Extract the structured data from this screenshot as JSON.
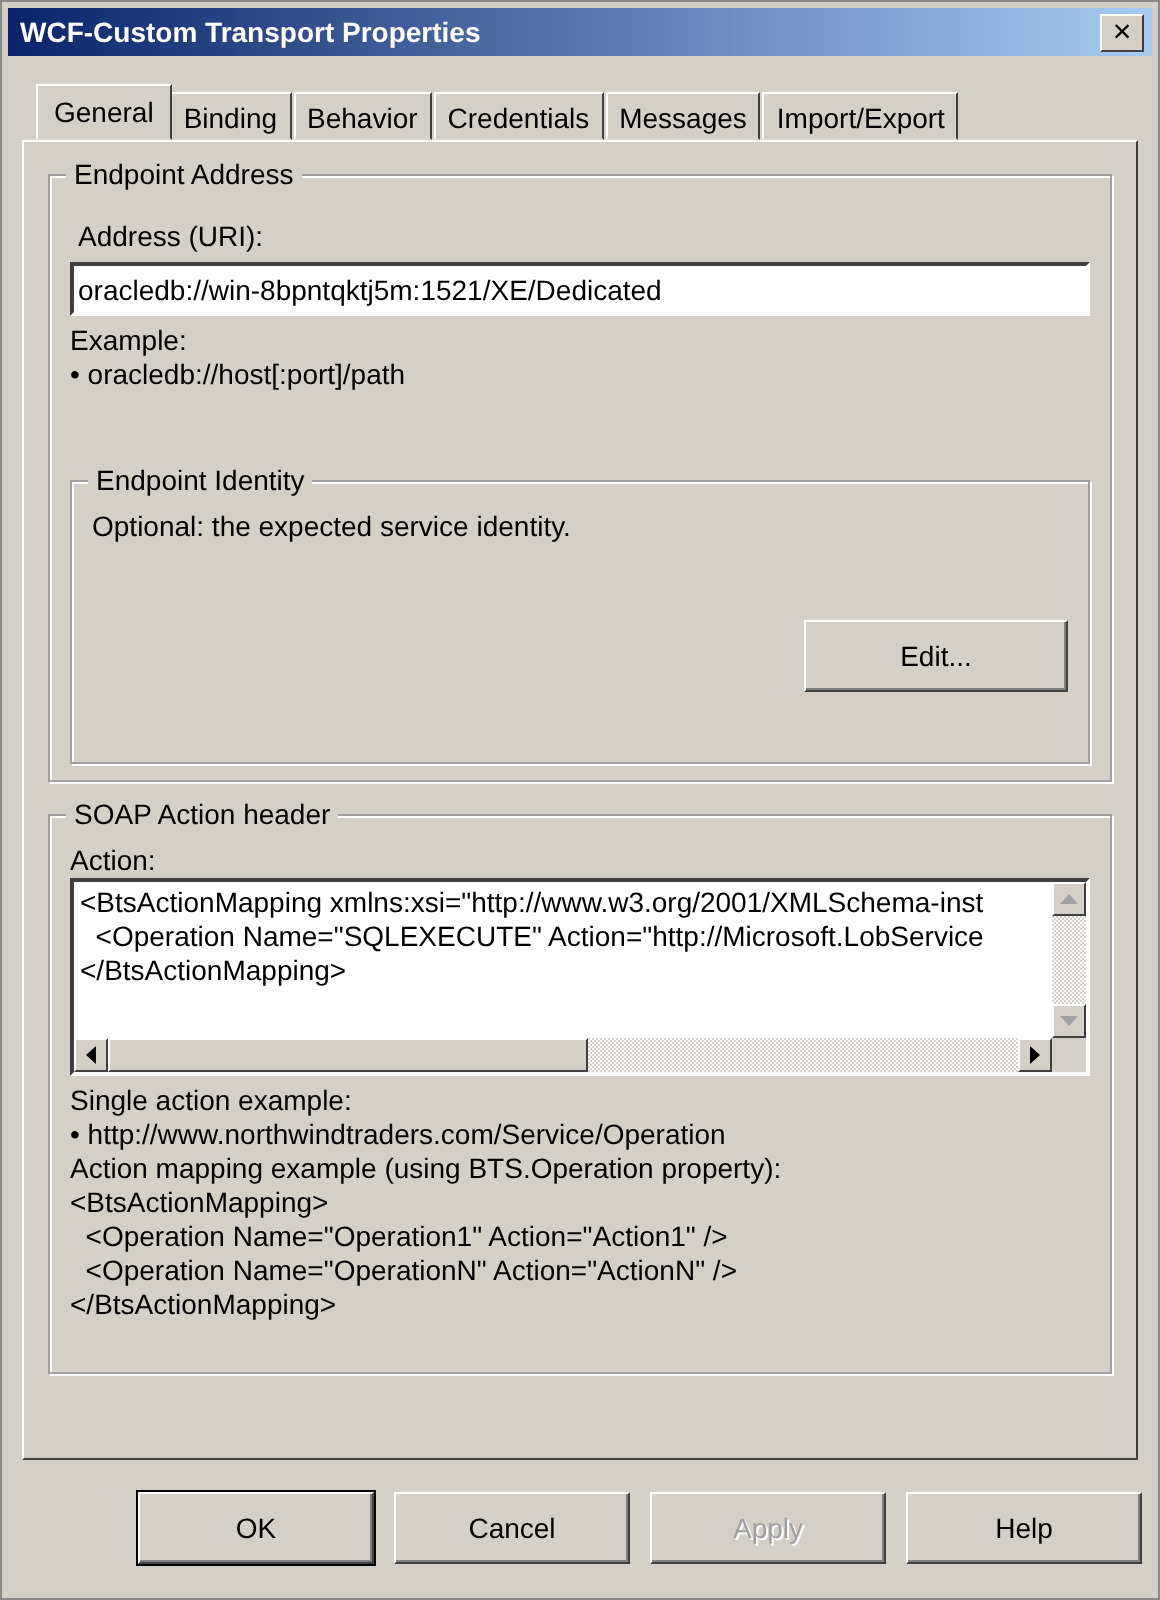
{
  "window": {
    "title": "WCF-Custom Transport Properties",
    "close": "×"
  },
  "tabs": [
    {
      "label": "General",
      "selected": true
    },
    {
      "label": "Binding",
      "selected": false
    },
    {
      "label": "Behavior",
      "selected": false
    },
    {
      "label": "Credentials",
      "selected": false
    },
    {
      "label": "Messages",
      "selected": false
    },
    {
      "label": "Import/Export",
      "selected": false
    }
  ],
  "endpoint_address": {
    "title": "Endpoint Address",
    "address_label": "Address (URI):",
    "address_value": "oracledb://win-8bpntqktj5m:1521/XE/Dedicated",
    "example_lines": [
      "Example:",
      "• oracledb://host[:port]/path"
    ],
    "endpoint_identity": {
      "title": "Endpoint Identity",
      "description": "Optional: the expected service identity.",
      "button": "Edit..."
    }
  },
  "soap_action": {
    "title": "SOAP Action header",
    "action_label": "Action:",
    "action_lines": [
      "<BtsActionMapping xmlns:xsi=\"http://www.w3.org/2001/XMLSchema-inst",
      "  <Operation Name=\"SQLEXECUTE\" Action=\"http://Microsoft.LobService",
      "</BtsActionMapping>"
    ],
    "help_lines": [
      "Single action example:",
      "• http://www.northwindtraders.com/Service/Operation",
      "Action mapping example (using BTS.Operation property):",
      "<BtsActionMapping>",
      "  <Operation Name=\"Operation1\" Action=\"Action1\" />",
      "  <Operation Name=\"OperationN\" Action=\"ActionN\" />",
      "</BtsActionMapping>"
    ]
  },
  "buttons": [
    {
      "label": "OK",
      "default": true,
      "disabled": false
    },
    {
      "label": "Cancel",
      "default": false,
      "disabled": false
    },
    {
      "label": "Apply",
      "default": false,
      "disabled": true
    },
    {
      "label": "Help",
      "default": false,
      "disabled": false
    }
  ]
}
